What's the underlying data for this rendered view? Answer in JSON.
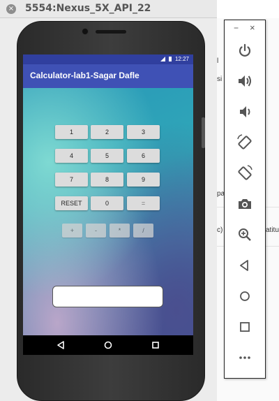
{
  "window": {
    "close_symbol": "×",
    "title": "5554:Nexus_5X_API_22"
  },
  "status_bar": {
    "time": "12:27"
  },
  "app": {
    "title": "Calculator-lab1-Sagar Dafle"
  },
  "keypad": {
    "rows": [
      [
        "1",
        "2",
        "3"
      ],
      [
        "4",
        "5",
        "6"
      ],
      [
        "7",
        "8",
        "9"
      ],
      [
        "RESET",
        "0",
        "="
      ]
    ],
    "operators": [
      "+",
      "-",
      "*",
      "/"
    ]
  },
  "result_field": {
    "value": ""
  },
  "nav_bar": {
    "buttons": [
      "back-icon",
      "home-icon",
      "overview-icon"
    ]
  },
  "side_toolbar": {
    "minimize": "−",
    "close": "×",
    "buttons": [
      "power-icon",
      "volume-up-icon",
      "volume-down-icon",
      "rotate-left-icon",
      "rotate-right-icon",
      "camera-icon",
      "zoom-icon",
      "back-icon",
      "home-icon",
      "overview-icon",
      "more-icon"
    ]
  },
  "background_window": {
    "fragments": [
      "l",
      "si",
      "pa",
      "c)",
      "atitu"
    ]
  },
  "colors": {
    "app_bar": "#3f51b5",
    "status_bar": "#303f9f"
  }
}
